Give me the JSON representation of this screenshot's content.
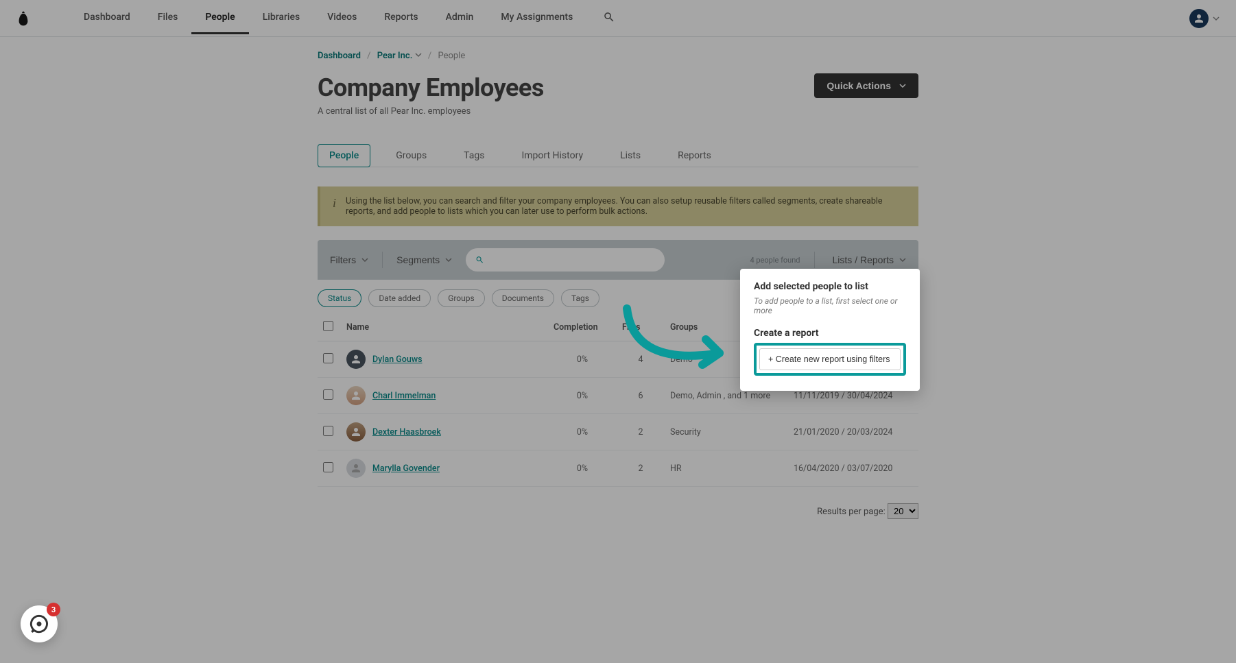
{
  "nav": {
    "items": [
      "Dashboard",
      "Files",
      "People",
      "Libraries",
      "Videos",
      "Reports",
      "Admin",
      "My Assignments"
    ],
    "activeIndex": 2
  },
  "breadcrumb": {
    "dashboard": "Dashboard",
    "company": "Pear Inc.",
    "current": "People"
  },
  "pageTitle": "Company Employees",
  "pageSubtitle": "A central list of all Pear Inc. employees",
  "quickActions": "Quick Actions",
  "subTabs": {
    "items": [
      "People",
      "Groups",
      "Tags",
      "Import History",
      "Lists",
      "Reports"
    ],
    "activeIndex": 0
  },
  "infoBanner": "Using the list below, you can search and filter your company employees. You can also setup reusable filters called segments, create shareable reports, and add people to lists which you can later use to perform bulk actions.",
  "toolbar": {
    "filters": "Filters",
    "segments": "Segments",
    "searchPlaceholder": "",
    "foundText": "4 people found",
    "listsReports": "Lists / Reports"
  },
  "chips": [
    "Status",
    "Date added",
    "Groups",
    "Documents",
    "Tags"
  ],
  "chipActiveIndex": 0,
  "columns": {
    "name": "Name",
    "completion": "Completion",
    "files": "Files",
    "groups": "Groups",
    "dates": ""
  },
  "rows": [
    {
      "name": "Dylan Gouws",
      "completion": "0%",
      "files": "4",
      "groups": "Demo",
      "dates": "",
      "avatar": "filled"
    },
    {
      "name": "Charl Immelman",
      "completion": "0%",
      "files": "6",
      "groups": "Demo, Admin , and 1 more",
      "dates": "11/11/2019 / 30/04/2024",
      "avatar": "photo"
    },
    {
      "name": "Dexter Haasbroek",
      "completion": "0%",
      "files": "2",
      "groups": "Security",
      "dates": "21/01/2020 / 20/03/2024",
      "avatar": "photo2"
    },
    {
      "name": "Marylla Govender",
      "completion": "0%",
      "files": "2",
      "groups": "HR",
      "dates": "16/04/2020 / 03/07/2020",
      "avatar": "placeholder"
    }
  ],
  "pager": {
    "label": "Results per page:",
    "value": "20"
  },
  "popover": {
    "addTitle": "Add selected people to list",
    "addHint": "To add people to a list, first select one or more",
    "reportTitle": "Create a report",
    "createBtn": "+ Create new report using filters"
  },
  "widgetBadge": "3"
}
